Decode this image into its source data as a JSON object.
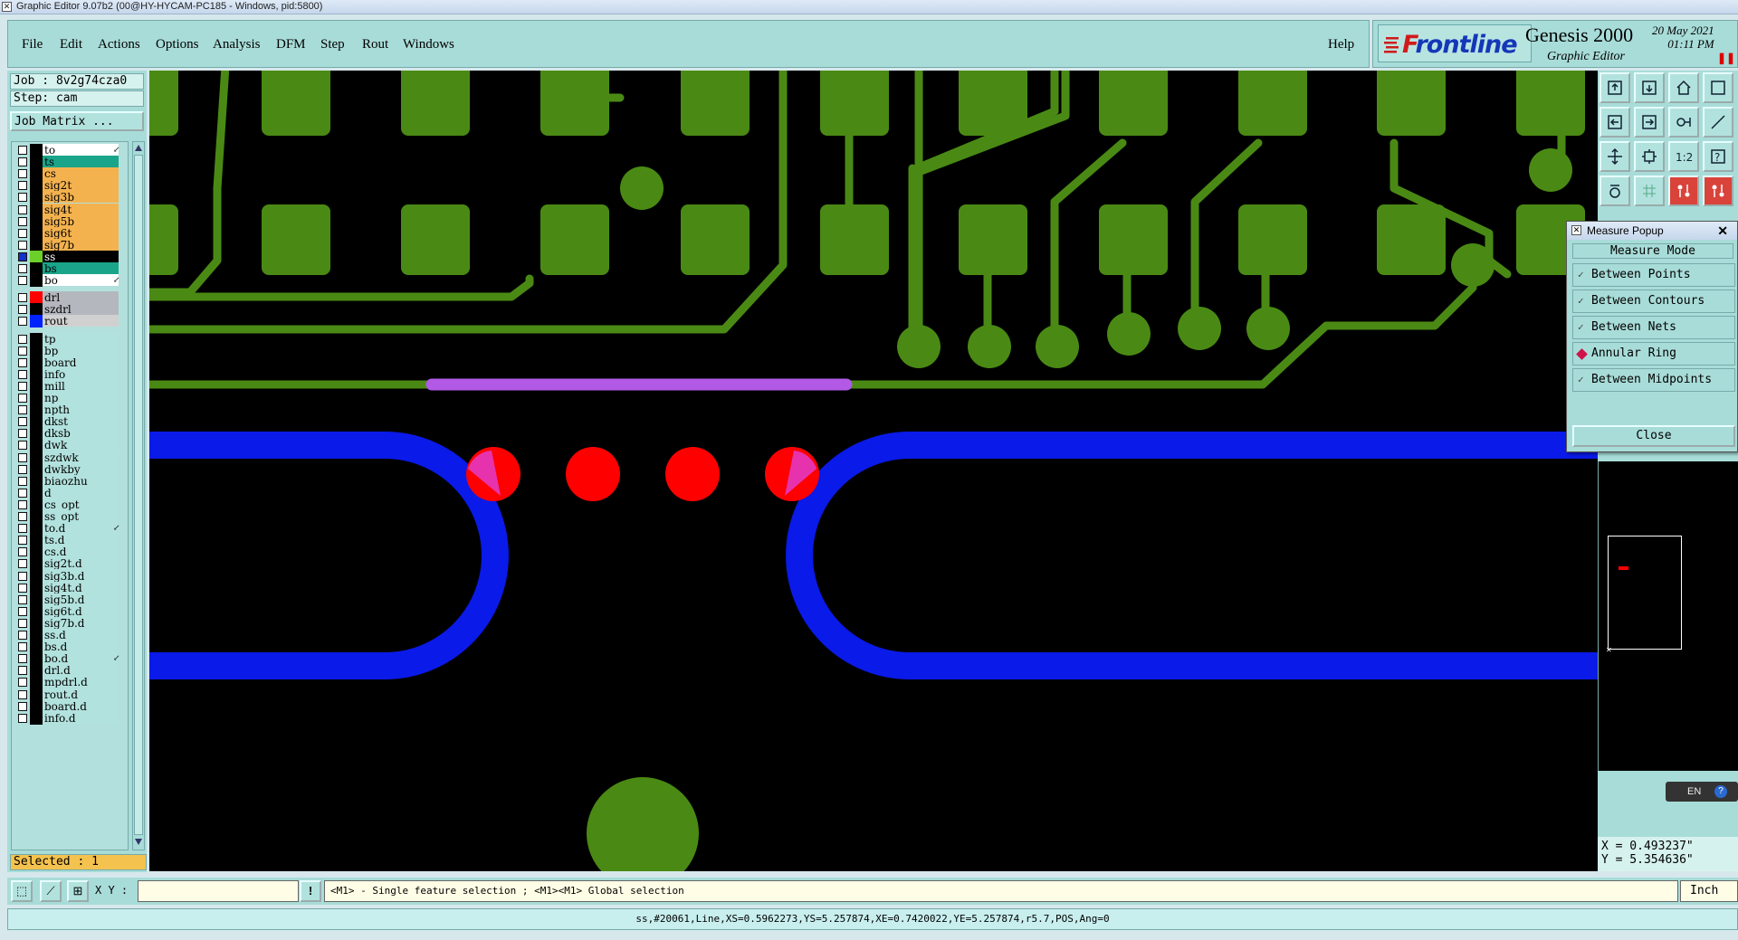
{
  "window": {
    "title": "Graphic Editor 9.07b2 (00@HY-HYCAM-PC185 - Windows, pid:5800)"
  },
  "menu": {
    "file": "File",
    "edit": "Edit",
    "actions": "Actions",
    "options": "Options",
    "analysis": "Analysis",
    "dfm": "DFM",
    "step": "Step",
    "rout": "Rout",
    "windows": "Windows",
    "help": "Help"
  },
  "brand": {
    "logo": "Frontline",
    "product": "Genesis 2000",
    "subtitle": "Graphic Editor",
    "date": "20 May 2021",
    "time": "01:11 PM"
  },
  "job": {
    "job_label": "Job : 8v2g74cza0",
    "step_label": "Step: cam",
    "matrix_button": "Job Matrix ..."
  },
  "layers": [
    {
      "name": "to",
      "bg": "#ffffff",
      "color": "#000000",
      "mark": "↙"
    },
    {
      "name": "ts",
      "bg": "#1aa58a",
      "color": "#000000",
      "mark": ""
    },
    {
      "name": "cs",
      "bg": "#f4b24e",
      "color": "#000000",
      "mark": ""
    },
    {
      "name": "sig2t",
      "bg": "#f4b24e",
      "color": "#000000",
      "mark": ""
    },
    {
      "name": "sig3b",
      "bg": "#f4b24e",
      "color": "#000000",
      "mark": ""
    },
    {
      "name": "sig4t",
      "bg": "#f4b24e",
      "color": "#000000",
      "mark": ""
    },
    {
      "name": "sig5b",
      "bg": "#f4b24e",
      "color": "#000000",
      "mark": ""
    },
    {
      "name": "sig6t",
      "bg": "#f4b24e",
      "color": "#000000",
      "mark": ""
    },
    {
      "name": "sig7b",
      "bg": "#f4b24e",
      "color": "#000000",
      "mark": ""
    },
    {
      "name": "ss",
      "bg": "#000000",
      "color": "#6cd02a",
      "mark": "▪",
      "active": true
    },
    {
      "name": "bs",
      "bg": "#1aa58a",
      "color": "#000000",
      "mark": ""
    },
    {
      "name": "bo",
      "bg": "#ffffff",
      "color": "#000000",
      "mark": "↙"
    },
    {
      "name": "drl",
      "bg": "#b4b8be",
      "color": "#ff0000",
      "mark": ""
    },
    {
      "name": "szdrl",
      "bg": "#b4b8be",
      "color": "#000000",
      "mark": ""
    },
    {
      "name": "rout",
      "bg": "#d0d0d0",
      "color": "#0022ff",
      "mark": ""
    },
    {
      "name": "tp",
      "bg": "#b2e2de",
      "color": "#000000",
      "mark": ""
    },
    {
      "name": "bp",
      "bg": "#b2e2de",
      "color": "#000000",
      "mark": ""
    },
    {
      "name": "board",
      "bg": "#b2e2de",
      "color": "#000000",
      "mark": ""
    },
    {
      "name": "info",
      "bg": "#b2e2de",
      "color": "#000000",
      "mark": ""
    },
    {
      "name": "mill",
      "bg": "#b2e2de",
      "color": "#000000",
      "mark": ""
    },
    {
      "name": "np",
      "bg": "#b2e2de",
      "color": "#000000",
      "mark": ""
    },
    {
      "name": "npth",
      "bg": "#b2e2de",
      "color": "#000000",
      "mark": ""
    },
    {
      "name": "dkst",
      "bg": "#b2e2de",
      "color": "#000000",
      "mark": ""
    },
    {
      "name": "dksb",
      "bg": "#b2e2de",
      "color": "#000000",
      "mark": ""
    },
    {
      "name": "dwk",
      "bg": "#b2e2de",
      "color": "#000000",
      "mark": ""
    },
    {
      "name": "szdwk",
      "bg": "#b2e2de",
      "color": "#000000",
      "mark": ""
    },
    {
      "name": "dwkby",
      "bg": "#b2e2de",
      "color": "#000000",
      "mark": ""
    },
    {
      "name": "biaozhu",
      "bg": "#b2e2de",
      "color": "#000000",
      "mark": ""
    },
    {
      "name": "d",
      "bg": "#b2e2de",
      "color": "#000000",
      "mark": ""
    },
    {
      "name": "cs_opt",
      "bg": "#b2e2de",
      "color": "#000000",
      "mark": ""
    },
    {
      "name": "ss_opt",
      "bg": "#b2e2de",
      "color": "#000000",
      "mark": ""
    },
    {
      "name": "to.d",
      "bg": "#b2e2de",
      "color": "#000000",
      "mark": "↙"
    },
    {
      "name": "ts.d",
      "bg": "#b2e2de",
      "color": "#000000",
      "mark": ""
    },
    {
      "name": "cs.d",
      "bg": "#b2e2de",
      "color": "#000000",
      "mark": ""
    },
    {
      "name": "sig2t.d",
      "bg": "#b2e2de",
      "color": "#000000",
      "mark": ""
    },
    {
      "name": "sig3b.d",
      "bg": "#b2e2de",
      "color": "#000000",
      "mark": ""
    },
    {
      "name": "sig4t.d",
      "bg": "#b2e2de",
      "color": "#000000",
      "mark": ""
    },
    {
      "name": "sig5b.d",
      "bg": "#b2e2de",
      "color": "#000000",
      "mark": ""
    },
    {
      "name": "sig6t.d",
      "bg": "#b2e2de",
      "color": "#000000",
      "mark": ""
    },
    {
      "name": "sig7b.d",
      "bg": "#b2e2de",
      "color": "#000000",
      "mark": ""
    },
    {
      "name": "ss.d",
      "bg": "#b2e2de",
      "color": "#000000",
      "mark": ""
    },
    {
      "name": "bs.d",
      "bg": "#b2e2de",
      "color": "#000000",
      "mark": ""
    },
    {
      "name": "bo.d",
      "bg": "#b2e2de",
      "color": "#000000",
      "mark": "↙"
    },
    {
      "name": "drl.d",
      "bg": "#b2e2de",
      "color": "#000000",
      "mark": ""
    },
    {
      "name": "mpdrl.d",
      "bg": "#b2e2de",
      "color": "#000000",
      "mark": ""
    },
    {
      "name": "rout.d",
      "bg": "#b2e2de",
      "color": "#000000",
      "mark": ""
    },
    {
      "name": "board.d",
      "bg": "#b2e2de",
      "color": "#000000",
      "mark": ""
    },
    {
      "name": "info.d",
      "bg": "#b2e2de",
      "color": "#000000",
      "mark": ""
    }
  ],
  "selected": {
    "label": "Selected : 1"
  },
  "measure_popup": {
    "title": "Measure Popup",
    "mode_label": "Measure Mode",
    "options": [
      {
        "label": "Between Points",
        "selected": false
      },
      {
        "label": "Between Contours",
        "selected": false
      },
      {
        "label": "Between Nets",
        "selected": false
      },
      {
        "label": "Annular Ring",
        "selected": true
      },
      {
        "label": "Between Midpoints",
        "selected": false
      }
    ],
    "close_label": "Close"
  },
  "coords": {
    "x": "X = 0.493237\"",
    "y": "Y = 5.354636\""
  },
  "ime": {
    "label": "EN"
  },
  "bottom": {
    "xy_label": "X Y :",
    "xy_value": "",
    "prompt": "<M1> - Single feature selection ; <M1><M1> Global selection",
    "unit": "Inch"
  },
  "status": {
    "text": "ss,#20061,Line,XS=0.5962273,YS=5.257874,XE=0.7420022,YE=5.257874,r5.7,POS,Ang=0"
  },
  "colors": {
    "ss_layer": "#4a8a14",
    "highlight": "#b25ae6",
    "rout_layer": "#0a1ae8",
    "drill": "#ff0000",
    "panel": "#a8dcd8"
  }
}
